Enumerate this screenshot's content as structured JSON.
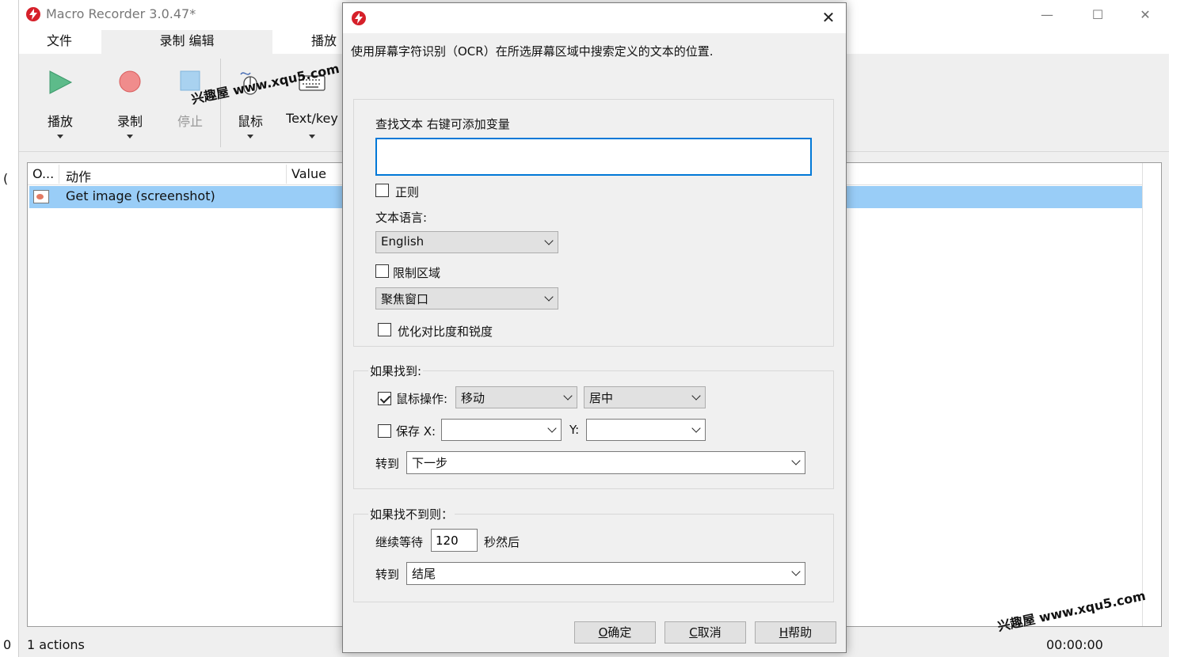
{
  "app": {
    "title": "Macro Recorder 3.0.47*",
    "window_controls": {
      "minimize": "—",
      "maximize": "☐",
      "close": "✕"
    },
    "menu_tabs": [
      {
        "label": "文件"
      },
      {
        "label": "录制 编辑"
      },
      {
        "label": "播放"
      }
    ],
    "ribbon": {
      "play": "播放",
      "record": "录制",
      "stop": "停止",
      "mouse": "鼠标",
      "textkey": "Text/key"
    },
    "list": {
      "columns": [
        "O...",
        "动作",
        "Value"
      ],
      "rows": [
        {
          "action": "Get image (screenshot)"
        }
      ]
    },
    "status": {
      "actions": "1 actions",
      "time": "00:00:00"
    },
    "left_stub_top": "(",
    "left_stub_bottom": "0"
  },
  "watermarks": {
    "top": "兴趣屋 www.xqu5.com",
    "bottom": "兴趣屋 www.xqu5.com"
  },
  "dialog": {
    "close": "✕",
    "description": "使用屏幕字符识别（OCR）在所选屏幕区域中搜索定义的文本的位置.",
    "search_label": "查找文本 右键可添加变量",
    "search_value": "",
    "regex_label": "正则",
    "regex_checked": false,
    "language_label": "文本语言:",
    "language_value": "English",
    "limit_area_label": "限制区域",
    "limit_area_checked": false,
    "area_value": "聚焦窗口",
    "optimize_label": "优化对比度和锐度",
    "optimize_checked": false,
    "if_found": {
      "title": "如果找到:",
      "mouse_action_label": "鼠标操作:",
      "mouse_action_checked": true,
      "mouse_action_value": "移动",
      "position_value": "居中",
      "save_label": "保存 X:",
      "save_checked": false,
      "save_x_value": "",
      "y_label": "Y:",
      "save_y_value": "",
      "goto_label": "转到",
      "goto_value": "下一步"
    },
    "if_not_found": {
      "title": "如果找不到则：",
      "wait_label": "继续等待",
      "wait_value": "120",
      "wait_suffix": "秒然后",
      "goto_label": "转到",
      "goto_value": "结尾"
    },
    "buttons": {
      "ok_key": "O",
      "ok_text": "确定",
      "cancel_key": "C",
      "cancel_text": "取消",
      "help_key": "H",
      "help_text": "帮助"
    }
  },
  "colors": {
    "accent": "#0078d7",
    "selection": "#99cdf7",
    "logo_red": "#d6202a",
    "play_green": "#5dbb8a",
    "record_red": "#f08c8c",
    "stop_blue": "#a9d2f0"
  }
}
